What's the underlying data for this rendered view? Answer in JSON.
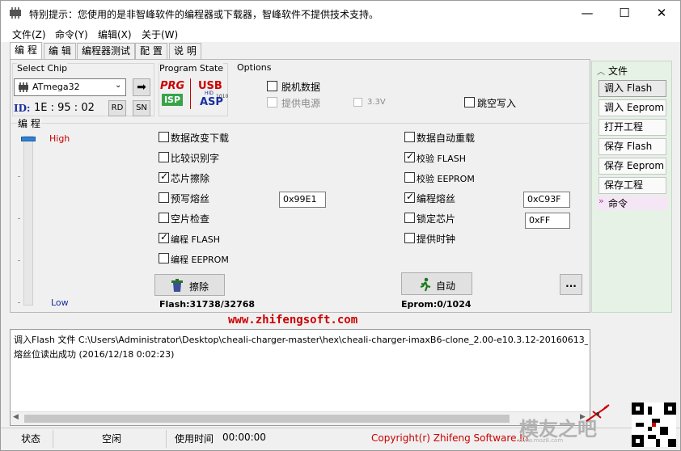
{
  "window": {
    "title": "特别提示：您使用的是非智峰软件的编程器或下载器，智峰软件不提供技术支持。",
    "minimize": "—",
    "maximize": "☐",
    "close": "✕"
  },
  "menu": [
    "文件(Z)",
    "命令(Y)",
    "编辑(X)",
    "关于(W)"
  ],
  "tabs": [
    "编 程",
    "编 辑",
    "编程器测试",
    "配 置",
    "说 明"
  ],
  "chip": {
    "group_label": "Select Chip",
    "selected": "ATmega32",
    "id_label": "ID:",
    "id_value": "1E : 95 : 02",
    "rd_button": "RD",
    "sn_button": "SN"
  },
  "program_state": {
    "label": "Program State",
    "prg": "PRG",
    "isp": "ISP",
    "usb": "USB",
    "asp": "ASP",
    "hid_text": "HID",
    "num_text": "1010"
  },
  "options": {
    "label": "Options",
    "offline": "脱机数据",
    "power": "提供电源",
    "voltage": "3.3V",
    "skip_blank": "跳空写入"
  },
  "program": {
    "label": "编 程",
    "high": "High",
    "low": "Low",
    "left_checks": [
      {
        "label": "数据改变下载",
        "checked": false
      },
      {
        "label": "比较识别字",
        "checked": false
      },
      {
        "label": "芯片擦除",
        "checked": true
      },
      {
        "label": "预写熔丝",
        "checked": false
      },
      {
        "label": "空片检查",
        "checked": false
      },
      {
        "label": "编程 FLASH",
        "checked": true
      },
      {
        "label": "编程 EEPROM",
        "checked": false
      }
    ],
    "right_checks": [
      {
        "label": "数据自动重载",
        "checked": false
      },
      {
        "label": "校验 FLASH",
        "checked": true
      },
      {
        "label": "校验 EEPROM",
        "checked": false
      },
      {
        "label": "编程熔丝",
        "checked": true
      },
      {
        "label": "锁定芯片",
        "checked": false
      },
      {
        "label": "提供时钟",
        "checked": false
      }
    ],
    "prefuse_value": "0x99E1",
    "fuse_value": "0xC93F",
    "lock_value": "0xFF",
    "erase_button": "擦除",
    "auto_button": "自动",
    "more_button": "...",
    "flash_info": "Flash:31738/32768",
    "eprom_info": "Eprom:0/1024"
  },
  "website": "www.zhifengsoft.com",
  "sidebar": {
    "file_header": "文件",
    "buttons": [
      "调入 Flash",
      "调入 Eeprom",
      "打开工程",
      "保存 Flash",
      "保存 Eeprom",
      "保存工程"
    ],
    "cmd_header": "命令"
  },
  "log": [
    "调入Flash 文件 C:\\Users\\Administrator\\Desktop\\cheali-charger-master\\hex\\cheali-charger-imaxB6-clone_2.00-e10.3.12-20160613_atmega32.hex",
    "熔丝位读出成功 (2016/12/18 0:02:23)"
  ],
  "status": {
    "state_label": "状态",
    "state_value": "空闲",
    "time_label": "使用时间",
    "time_value": "00:00:00",
    "copyright": "Copyright(r) Zhifeng Software.In",
    "watermark": "模友之吧",
    "watermark_url": "www.moz8.com"
  },
  "colors": {
    "accent_red": "#cc0000",
    "link_blue": "#1a2fa0",
    "sidebar_bg": "#e5f2e5"
  }
}
